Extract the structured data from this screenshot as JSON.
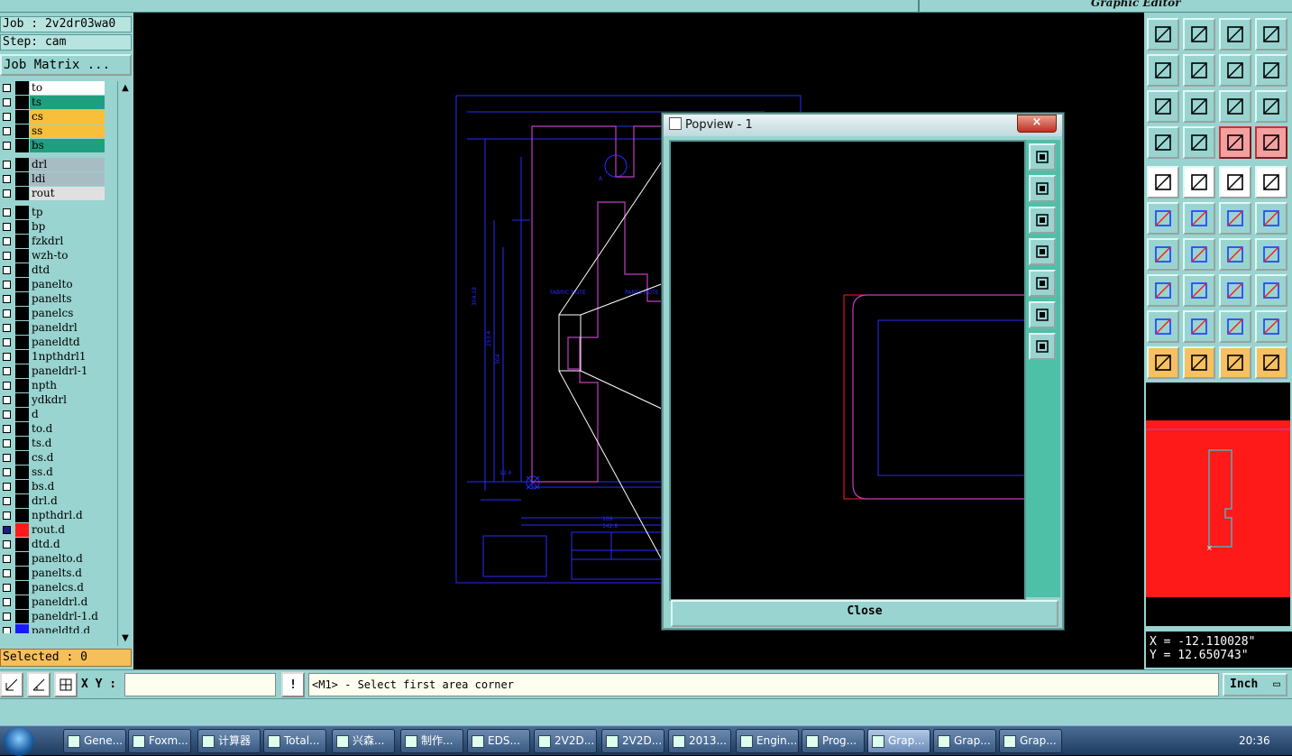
{
  "window": {
    "title_right": "Graphic Editor"
  },
  "job": {
    "job_line": "Job : 2v2dr03wa0",
    "step_line": "Step: cam",
    "matrix_btn": "Job Matrix ..."
  },
  "layers": [
    {
      "name": "to",
      "color": "#ffffff",
      "swatch": "#000000"
    },
    {
      "name": "ts",
      "color": "#1ea080",
      "swatch": "#000000"
    },
    {
      "name": "cs",
      "color": "#f7bf3a",
      "swatch": "#000000"
    },
    {
      "name": "ss",
      "color": "#f7bf3a",
      "swatch": "#000000"
    },
    {
      "name": "bs",
      "color": "#1ea080",
      "swatch": "#000000"
    },
    {
      "name": "drl",
      "color": "#a8bcc4",
      "swatch": "#000000"
    },
    {
      "name": "ldi",
      "color": "#a8bcc4",
      "swatch": "#000000"
    },
    {
      "name": "rout",
      "color": "#e0e0e0",
      "swatch": "#000000"
    },
    {
      "name": "tp",
      "color": "#99d4d0",
      "swatch": "#000000"
    },
    {
      "name": "bp",
      "color": "#99d4d0",
      "swatch": "#000000"
    },
    {
      "name": "fzkdrl",
      "color": "#99d4d0",
      "swatch": "#000000"
    },
    {
      "name": "wzh-to",
      "color": "#99d4d0",
      "swatch": "#000000"
    },
    {
      "name": "dtd",
      "color": "#99d4d0",
      "swatch": "#000000"
    },
    {
      "name": "panelto",
      "color": "#99d4d0",
      "swatch": "#000000"
    },
    {
      "name": "panelts",
      "color": "#99d4d0",
      "swatch": "#000000"
    },
    {
      "name": "panelcs",
      "color": "#99d4d0",
      "swatch": "#000000"
    },
    {
      "name": "paneldrl",
      "color": "#99d4d0",
      "swatch": "#000000"
    },
    {
      "name": "paneldtd",
      "color": "#99d4d0",
      "swatch": "#000000"
    },
    {
      "name": "1npthdrl1",
      "color": "#99d4d0",
      "swatch": "#000000"
    },
    {
      "name": "paneldrl-1",
      "color": "#99d4d0",
      "swatch": "#000000"
    },
    {
      "name": "npth",
      "color": "#99d4d0",
      "swatch": "#000000"
    },
    {
      "name": "ydkdrl",
      "color": "#99d4d0",
      "swatch": "#000000"
    },
    {
      "name": "d",
      "color": "#99d4d0",
      "swatch": "#000000"
    },
    {
      "name": "to.d",
      "color": "#99d4d0",
      "swatch": "#000000"
    },
    {
      "name": "ts.d",
      "color": "#99d4d0",
      "swatch": "#000000"
    },
    {
      "name": "cs.d",
      "color": "#99d4d0",
      "swatch": "#000000"
    },
    {
      "name": "ss.d",
      "color": "#99d4d0",
      "swatch": "#000000"
    },
    {
      "name": "bs.d",
      "color": "#99d4d0",
      "swatch": "#000000"
    },
    {
      "name": "drl.d",
      "color": "#99d4d0",
      "swatch": "#000000"
    },
    {
      "name": "npthdrl.d",
      "color": "#99d4d0",
      "swatch": "#000000"
    },
    {
      "name": "rout.d",
      "color": "#99d4d0",
      "swatch": "#ff1a1a",
      "checked": true
    },
    {
      "name": "dtd.d",
      "color": "#99d4d0",
      "swatch": "#000000"
    },
    {
      "name": "panelto.d",
      "color": "#99d4d0",
      "swatch": "#000000"
    },
    {
      "name": "panelts.d",
      "color": "#99d4d0",
      "swatch": "#000000"
    },
    {
      "name": "panelcs.d",
      "color": "#99d4d0",
      "swatch": "#000000"
    },
    {
      "name": "paneldrl.d",
      "color": "#99d4d0",
      "swatch": "#000000"
    },
    {
      "name": "paneldrl-1.d",
      "color": "#99d4d0",
      "swatch": "#000000"
    },
    {
      "name": "paneldtd.d",
      "color": "#99d4d0",
      "swatch": "#1a1aff"
    }
  ],
  "selected": "Selected : 0",
  "popview": {
    "title": "Popview - 1",
    "close_x": "×",
    "close_btn": "Close"
  },
  "coords": {
    "x": "X = -12.110028\"",
    "y": "Y = 12.650743\""
  },
  "cmd": {
    "xy_label": "X Y :",
    "xy_value": "",
    "bang": "!",
    "message": "<M1> - Select first area corner",
    "unit": "Inch"
  },
  "drawing_labels": {
    "dim_109": "109",
    "dim_142": "142.8",
    "dim_304": "304",
    "dim_304_18": "304.18",
    "dim_293": "293.4",
    "dim_12": "12.4",
    "label_a": "A",
    "fab_note": "FABRIC NOTE",
    "panel_note": "PANEL NOTE"
  },
  "taskbar": [
    {
      "label": "Gene...",
      "active": false
    },
    {
      "label": "Foxm...",
      "active": false
    },
    {
      "label": "计算器",
      "active": false
    },
    {
      "label": "Total...",
      "active": false
    },
    {
      "label": "兴森...",
      "active": false
    },
    {
      "label": "制作...",
      "active": false
    },
    {
      "label": "EDS...",
      "active": false
    },
    {
      "label": "2V2D...",
      "active": false
    },
    {
      "label": "2V2D...",
      "active": false
    },
    {
      "label": "2013...",
      "active": false
    },
    {
      "label": "Engin...",
      "active": false
    },
    {
      "label": "Prog...",
      "active": false
    },
    {
      "label": "Grap...",
      "active": true
    },
    {
      "label": "Grap...",
      "active": false
    },
    {
      "label": "Grap...",
      "active": false
    }
  ],
  "clock": "20:36",
  "colors": {
    "panel": "#99d4d0",
    "canvas": "#000000",
    "route_red": "#ff1a1a",
    "outline_blue": "#2a2aff",
    "outline_magenta": "#c040c0"
  }
}
